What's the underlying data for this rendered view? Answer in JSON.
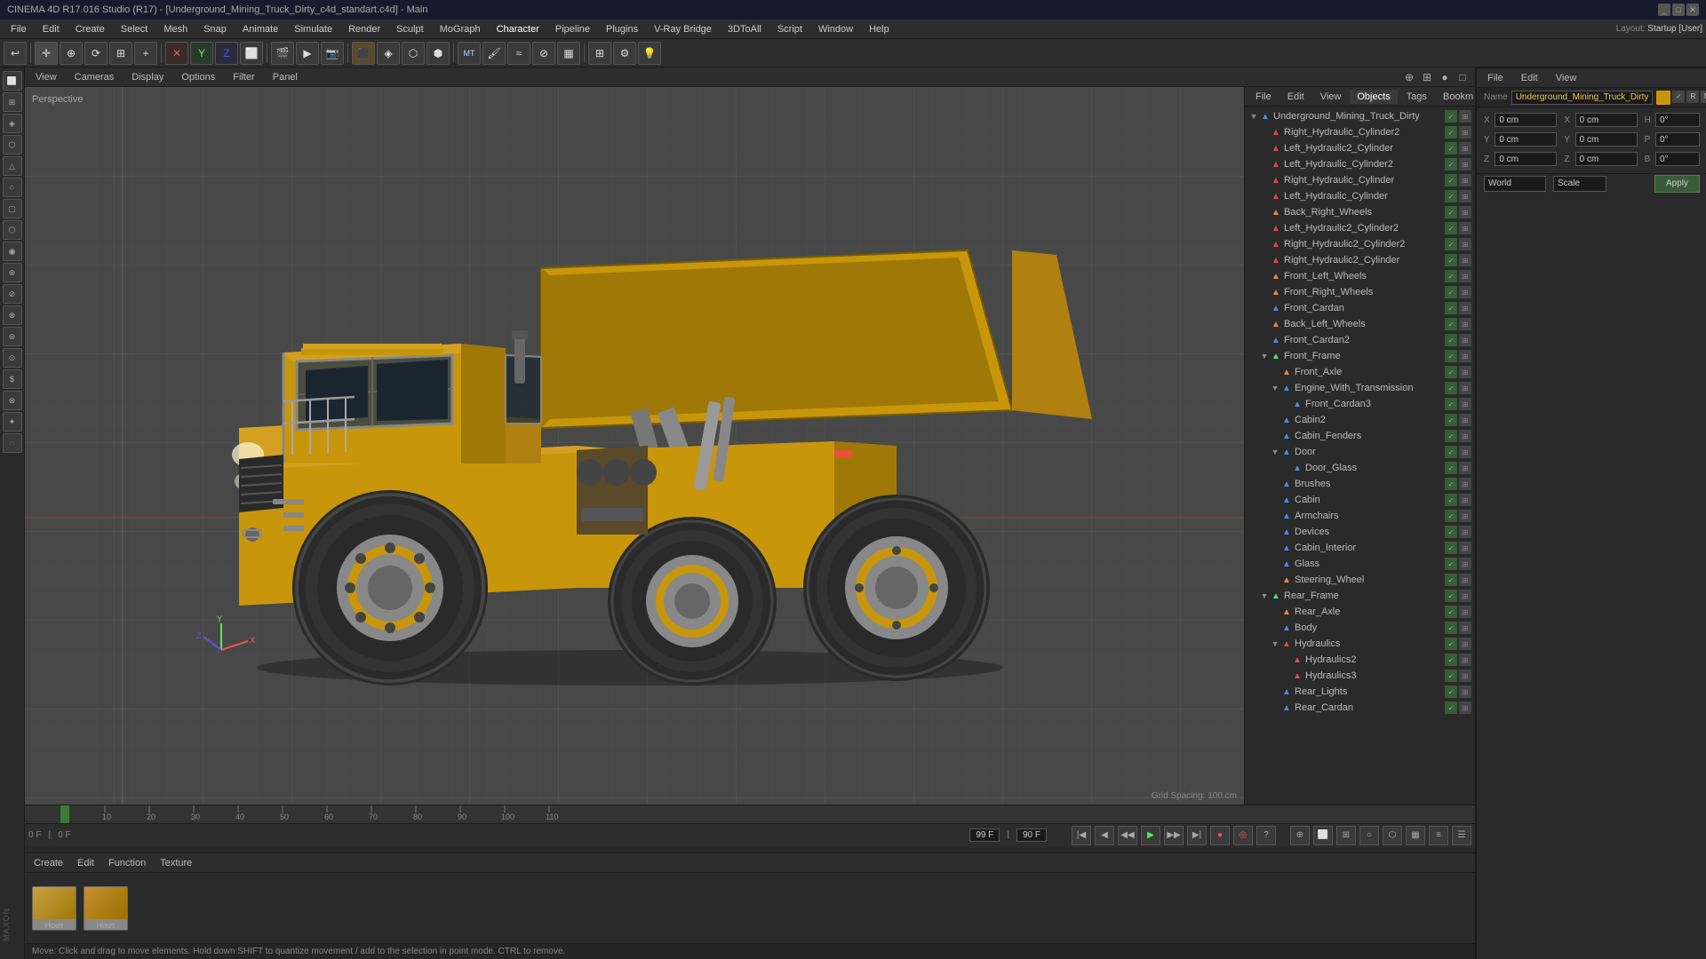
{
  "titlebar": {
    "title": "CINEMA 4D R17.016 Studio (R17) - [Underground_Mining_Truck_Dirty_c4d_standart.c4d] - Main"
  },
  "menubar": {
    "items": [
      "File",
      "Edit",
      "Create",
      "Select",
      "Mesh",
      "Snap",
      "Animate",
      "Simulate",
      "Render",
      "Sculpt",
      "MoGraph",
      "Character",
      "Pipeline",
      "Plugins",
      "V-Ray Bridge",
      "3DToAll",
      "Script",
      "Window",
      "Help"
    ]
  },
  "toolbar": {
    "layout_label": "Layout:",
    "layout_value": "Startup [User]"
  },
  "viewport": {
    "label": "Perspective",
    "grid_spacing": "Grid Spacing: 100 cm",
    "menus": [
      "View",
      "Cameras",
      "Display",
      "Options",
      "Filter",
      "Panel"
    ]
  },
  "timeline": {
    "current_frame": "0 F",
    "start_frame": "0 F",
    "end_frame": "90 F",
    "total_frames": "90 F",
    "ticks": [
      "0",
      "10",
      "20",
      "30",
      "40",
      "50",
      "60",
      "70",
      "80",
      "90",
      "100",
      "110"
    ]
  },
  "material_panel": {
    "menus": [
      "Create",
      "Edit",
      "Function",
      "Texture"
    ],
    "swatches": [
      {
        "label": "Hous",
        "color": "#c8a040"
      },
      {
        "label": "Hous",
        "color": "#c89030"
      }
    ]
  },
  "status_bar": {
    "text": "Move: Click and drag to move elements. Hold down SHIFT to quantize movement / add to the selection in point mode. CTRL to remove."
  },
  "right_panel": {
    "tabs": [
      "File",
      "Edit",
      "View",
      "Objects",
      "Tags",
      "Bookm"
    ],
    "tree_items": [
      {
        "name": "Underground_Mining_Truck_Dirty",
        "level": 0,
        "has_children": true,
        "expanded": true
      },
      {
        "name": "Right_Hydraulic_Cylinder2",
        "level": 1,
        "has_children": false
      },
      {
        "name": "Left_Hydraulic2_Cylinder",
        "level": 1,
        "has_children": false
      },
      {
        "name": "Left_Hydraulic_Cylinder2",
        "level": 1,
        "has_children": false
      },
      {
        "name": "Right_Hydraulic_Cylinder",
        "level": 1,
        "has_children": false
      },
      {
        "name": "Left_Hydraulic_Cylinder",
        "level": 1,
        "has_children": false
      },
      {
        "name": "Back_Right_Wheels",
        "level": 1,
        "has_children": false
      },
      {
        "name": "Left_Hydraulic2_Cylinder2",
        "level": 1,
        "has_children": false
      },
      {
        "name": "Right_Hydraulic2_Cylinder2",
        "level": 1,
        "has_children": false
      },
      {
        "name": "Right_Hydraulic2_Cylinder",
        "level": 1,
        "has_children": false
      },
      {
        "name": "Front_Left_Wheels",
        "level": 1,
        "has_children": false
      },
      {
        "name": "Front_Right_Wheels",
        "level": 1,
        "has_children": false
      },
      {
        "name": "Front_Cardan",
        "level": 1,
        "has_children": false
      },
      {
        "name": "Back_Left_Wheels",
        "level": 1,
        "has_children": false
      },
      {
        "name": "Front_Cardan2",
        "level": 1,
        "has_children": false
      },
      {
        "name": "Front_Frame",
        "level": 1,
        "has_children": true,
        "expanded": true
      },
      {
        "name": "Front_Axle",
        "level": 2,
        "has_children": false
      },
      {
        "name": "Engine_With_Transmission",
        "level": 2,
        "has_children": true,
        "expanded": true
      },
      {
        "name": "Front_Cardan3",
        "level": 3,
        "has_children": false
      },
      {
        "name": "Cabin2",
        "level": 2,
        "has_children": false
      },
      {
        "name": "Cabin_Fenders",
        "level": 2,
        "has_children": false
      },
      {
        "name": "Door",
        "level": 2,
        "has_children": true,
        "expanded": true
      },
      {
        "name": "Door_Glass",
        "level": 3,
        "has_children": false
      },
      {
        "name": "Brushes",
        "level": 2,
        "has_children": false
      },
      {
        "name": "Cabin",
        "level": 2,
        "has_children": false
      },
      {
        "name": "Armchairs",
        "level": 2,
        "has_children": false
      },
      {
        "name": "Devices",
        "level": 2,
        "has_children": false
      },
      {
        "name": "Cabin_Interior",
        "level": 2,
        "has_children": false
      },
      {
        "name": "Glass",
        "level": 2,
        "has_children": false
      },
      {
        "name": "Steering_Wheel",
        "level": 2,
        "has_children": false
      },
      {
        "name": "Rear_Frame",
        "level": 1,
        "has_children": true,
        "expanded": true
      },
      {
        "name": "Rear_Axle",
        "level": 2,
        "has_children": false
      },
      {
        "name": "Body",
        "level": 2,
        "has_children": false
      },
      {
        "name": "Hydraulics",
        "level": 2,
        "has_children": true,
        "expanded": true
      },
      {
        "name": "Hydraulics2",
        "level": 3,
        "has_children": false
      },
      {
        "name": "Hydraulics3",
        "level": 3,
        "has_children": false
      },
      {
        "name": "Rear_Lights",
        "level": 2,
        "has_children": false
      },
      {
        "name": "Rear_Cardan",
        "level": 2,
        "has_children": false
      }
    ]
  },
  "bottom_right": {
    "tabs": [
      "File",
      "Edit",
      "View"
    ],
    "name_label": "Name",
    "name_value": "Underground_Mining_Truck_Dirty",
    "coords": {
      "x_label": "X",
      "y_label": "Y",
      "z_label": "Z",
      "x_val": "0 cm",
      "y_val": "0 cm",
      "z_val": "0 cm",
      "x2_val": "0 cm",
      "y2_val": "0 cm",
      "z2_val": "0 cm",
      "h_val": "0°",
      "p_val": "0°",
      "b_val": "0°"
    },
    "world_label": "World",
    "scale_label": "Scale",
    "apply_label": "Apply"
  }
}
